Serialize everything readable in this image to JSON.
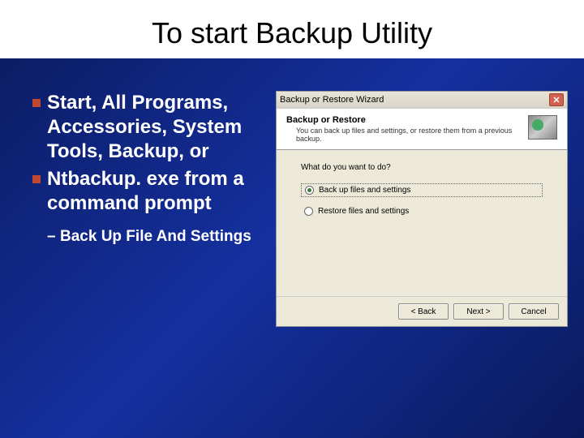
{
  "slide": {
    "title": "To start Backup Utility",
    "bullets": [
      "Start, All Programs, Accessories, System Tools, Backup, or",
      "Ntbackup. exe from a command prompt"
    ],
    "sub": "Back Up File And Settings"
  },
  "wizard": {
    "titlebar": "Backup or Restore Wizard",
    "header_title": "Backup or Restore",
    "header_sub": "You can back up files and settings, or restore them from a previous backup.",
    "question": "What do you want to do?",
    "opt1": "Back up files and settings",
    "opt2": "Restore files and settings",
    "back": "< Back",
    "next": "Next >",
    "cancel": "Cancel"
  }
}
